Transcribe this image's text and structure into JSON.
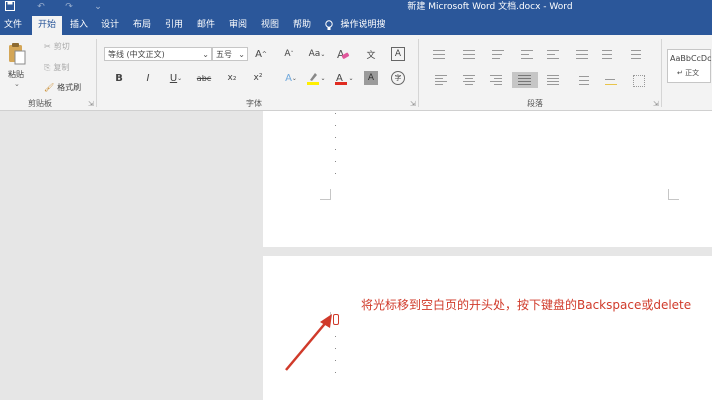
{
  "window": {
    "title": "新建 Microsoft Word 文档.docx  -  Word"
  },
  "tabs": [
    "文件",
    "开始",
    "插入",
    "设计",
    "布局",
    "引用",
    "邮件",
    "审阅",
    "视图",
    "帮助"
  ],
  "tell_me": "操作说明搜索",
  "clipboard": {
    "paste": "粘贴",
    "cut": "剪切",
    "copy": "复制",
    "format_painter": "格式刷",
    "group_label": "剪贴板"
  },
  "font": {
    "name": "等线 (中文正文)",
    "size": "五号",
    "group_label": "字体",
    "grow": "A",
    "shrink": "A",
    "case": "Aa",
    "bold": "B",
    "italic": "I",
    "underline": "U",
    "strike": "abc",
    "subscript": "x₂",
    "superscript": "x²",
    "text_effect": "A",
    "font_color": "A",
    "char_shading": "A",
    "char_border": "A",
    "phonetic": "文",
    "enclose": "字",
    "highlight_color": "#ffef00",
    "font_color_value": "#e02b20"
  },
  "paragraph": {
    "group_label": "段落"
  },
  "styles": {
    "preview": "AaBbCcDc",
    "name": "↵ 正文"
  },
  "document": {
    "instruction": "将光标移到空白页的开头处，按下键盘的Backspace或delete",
    "accent_color": "#d03a2a"
  },
  "theme": {
    "title_bar_color": "#2b579a",
    "ribbon_color": "#f3f3f3"
  }
}
